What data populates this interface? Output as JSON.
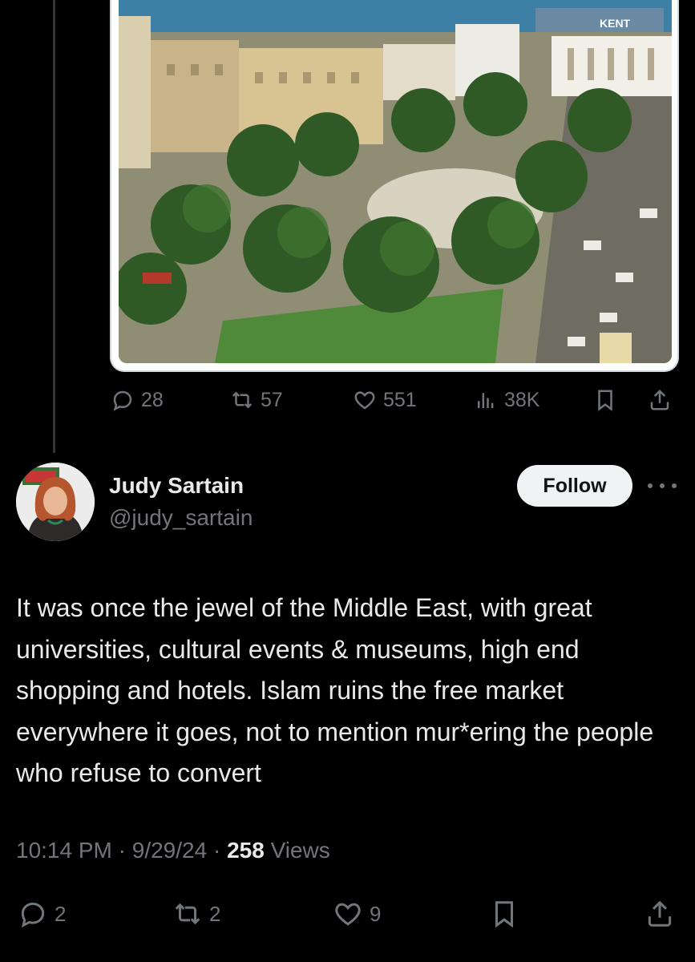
{
  "prev_tweet": {
    "image_sign": "KENT",
    "stats": {
      "replies": "28",
      "retweets": "57",
      "likes": "551",
      "views": "38K"
    },
    "icons": [
      "reply-icon",
      "retweet-icon",
      "like-icon",
      "views-icon",
      "bookmark-icon",
      "share-icon"
    ]
  },
  "tweet": {
    "name": "Judy Sartain",
    "handle": "@judy_sartain",
    "follow_label": "Follow",
    "text": "It was once the jewel of the Middle East, with great universities, cultural events & museums, high end shopping and hotels. Islam ruins the free market everywhere it goes, not to mention mur*ering the people who refuse to convert",
    "time": "10:14 PM",
    "date": "9/29/24",
    "views_count": "258",
    "views_label": "Views",
    "sep": "·",
    "stats": {
      "replies": "2",
      "retweets": "2",
      "likes": "9"
    }
  },
  "colors": {
    "background": "#000000",
    "text": "#e7e9ea",
    "muted": "#71767b",
    "follow_bg": "#eff3f4"
  }
}
